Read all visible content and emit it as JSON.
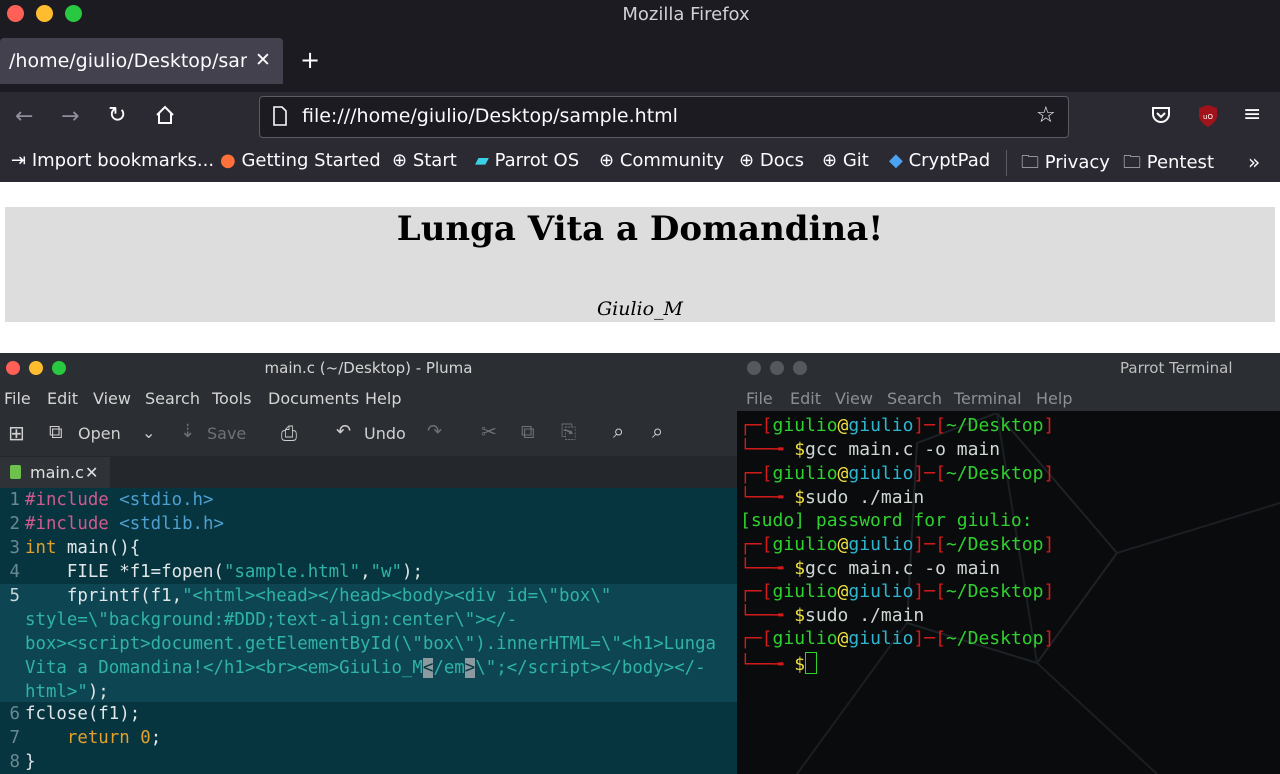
{
  "firefox": {
    "title": "Mozilla Firefox",
    "tab_title": "/home/giulio/Desktop/sample.html",
    "url": "file:///home/giulio/Desktop/sample.html",
    "bookmarks": [
      "Import bookmarks...",
      "Getting Started",
      "Start",
      "Parrot OS",
      "Community",
      "Docs",
      "Git",
      "CryptPad"
    ],
    "folders": [
      "Privacy",
      "Pentest"
    ],
    "page_heading": "Lunga Vita a Domandina!",
    "page_em": "Giulio_M"
  },
  "pluma": {
    "title": "main.c (~/Desktop) - Pluma",
    "menu": [
      "File",
      "Edit",
      "View",
      "Search",
      "Tools",
      "Documents",
      "Help"
    ],
    "toolbar": {
      "open": "Open",
      "save": "Save",
      "undo": "Undo"
    },
    "tab": "main.c",
    "line_numbers": [
      "1",
      "2",
      "3",
      "4",
      "5",
      "6",
      "7",
      "8"
    ]
  },
  "terminal": {
    "title": "Parrot Terminal",
    "menu": [
      "File",
      "Edit",
      "View",
      "Search",
      "Terminal",
      "Help"
    ],
    "user": "giulio",
    "host": "giulio",
    "cwd": "~/Desktop",
    "commands": [
      "gcc main.c -o main",
      "sudo ./main",
      "gcc main.c -o main",
      "sudo ./main"
    ],
    "sudo_prompt": "[sudo] password for giulio:"
  },
  "colors": {
    "firefox_bg": "#1c1b22",
    "editor_bg": "#07353f",
    "terminal_bg": "#0a0b0d"
  }
}
